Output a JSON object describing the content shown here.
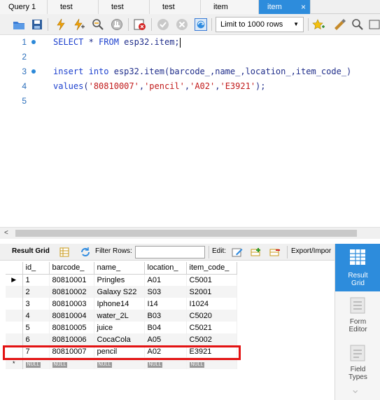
{
  "tabs": [
    {
      "label": "Query 1",
      "active": false
    },
    {
      "label": "test",
      "active": false
    },
    {
      "label": "test",
      "active": false
    },
    {
      "label": "test",
      "active": false
    },
    {
      "label": "item",
      "active": false
    },
    {
      "label": "item",
      "active": true,
      "close": "×"
    }
  ],
  "toolbar": {
    "limit_label": "Limit to 1000 rows",
    "icons": [
      "open-folder-icon",
      "save-icon",
      "execute-icon",
      "execute-cursor-icon",
      "explain-icon",
      "stop-icon",
      "toggle-error-icon",
      "commit-icon",
      "rollback-icon",
      "autocommit-icon",
      "limit-dropdown",
      "bookmark-icon",
      "beautify-icon",
      "find-icon"
    ]
  },
  "editor": {
    "lines": [
      {
        "num": "1",
        "dot": true
      },
      {
        "num": "2",
        "dot": false
      },
      {
        "num": "3",
        "dot": true
      },
      {
        "num": "4",
        "dot": false
      },
      {
        "num": "5",
        "dot": false
      }
    ],
    "line1": {
      "kw1": "SELECT",
      "rest1": " * ",
      "kw2": "FROM",
      "rest2": " esp32.item;"
    },
    "line3": {
      "kw1": "insert",
      "rest1": " ",
      "kw2": "into",
      "rest2": " esp32.item(barcode_,name_,location_,item_code_)"
    },
    "line4": {
      "kw1": "values",
      "p1": "(",
      "s1": "'80810007'",
      "c1": ",",
      "s2": "'pencil'",
      "c2": ",",
      "s3": "'A02'",
      "c3": ",",
      "s4": "'E3921'",
      "end": ");"
    }
  },
  "results_toolbar": {
    "result_grid_label": "Result Grid",
    "filter_label": "Filter Rows:",
    "filter_value": "",
    "edit_label": "Edit:",
    "export_label": "Export/Impor"
  },
  "grid": {
    "columns": [
      "id_",
      "barcode_",
      "name_",
      "location_",
      "item_code_"
    ],
    "rows": [
      [
        "1",
        "80810001",
        "Pringles",
        "A01",
        "C5001"
      ],
      [
        "2",
        "80810002",
        "Galaxy S22",
        "S03",
        "S2001"
      ],
      [
        "3",
        "80810003",
        "Iphone14",
        "I14",
        "I1024"
      ],
      [
        "4",
        "80810004",
        "water_2L",
        "B03",
        "C5020"
      ],
      [
        "5",
        "80810005",
        "juice",
        "B04",
        "C5021"
      ],
      [
        "6",
        "80810006",
        "CocaCola",
        "A05",
        "C5002"
      ],
      [
        "7",
        "80810007",
        "pencil",
        "A02",
        "E3921"
      ]
    ],
    "null_label": "NULL",
    "current_row_marker": "▶",
    "new_row_marker": "*"
  },
  "side_panel": {
    "items": [
      {
        "label_line1": "Result",
        "label_line2": "Grid",
        "active": true
      },
      {
        "label_line1": "Form",
        "label_line2": "Editor",
        "active": false
      },
      {
        "label_line1": "Field",
        "label_line2": "Types",
        "active": false
      }
    ]
  },
  "colors": {
    "accent": "#2d8cdc",
    "highlight": "#e31212",
    "keyword": "#1c40ce",
    "string": "#c11a1a"
  }
}
